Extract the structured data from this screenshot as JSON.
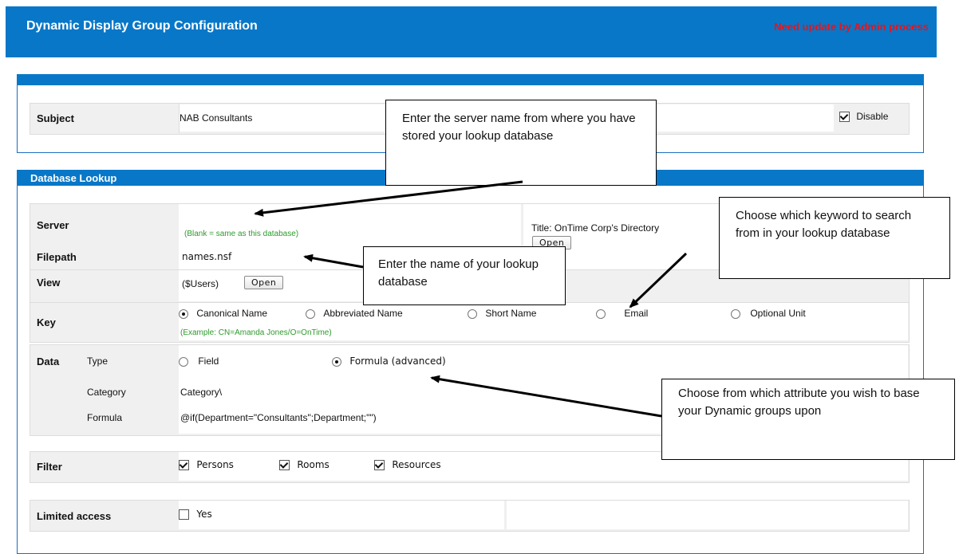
{
  "header": {
    "title": "Dynamic Display Group Configuration",
    "status": "Need update by Admin process"
  },
  "subject_section": {
    "label": "Subject",
    "value": "NAB Consultants",
    "disable_label": "Disable",
    "disable_checked": true
  },
  "db_section": {
    "title": "Database Lookup",
    "server": {
      "label": "Server",
      "hint": "(Blank = same as this database)"
    },
    "filepath": {
      "label": "Filepath",
      "value": "names.nsf"
    },
    "view": {
      "label": "View",
      "value": "($Users)",
      "open_label": "Open"
    },
    "title_info": {
      "text": "Title: OnTime Corp's Directory",
      "open_label": "Open"
    },
    "key": {
      "label": "Key",
      "options": [
        "Canonical Name",
        "Abbreviated Name",
        "Short Name",
        "Email",
        "Optional Unit"
      ],
      "selected": "Canonical Name",
      "example": "(Example: CN=Amanda Jones/O=OnTime)"
    },
    "data": {
      "label": "Data",
      "type_label": "Type",
      "type_options": [
        "Field",
        "Formula (advanced)"
      ],
      "type_selected": "Formula (advanced)",
      "category_label": "Category",
      "category_value": "Category\\",
      "formula_label": "Formula",
      "formula_value": "@if(Department=\"Consultants\";Department;\"\")"
    },
    "filter": {
      "label": "Filter",
      "options": [
        "Persons",
        "Rooms",
        "Resources"
      ]
    },
    "limited": {
      "label": "Limited access",
      "option": "Yes"
    }
  },
  "callouts": {
    "server": "Enter the server name from where you have stored your lookup database",
    "filepath": "Enter the name of your lookup database",
    "keyword": "Choose which keyword to search from in your lookup database",
    "attribute": "Choose from which attribute you wish to base your Dynamic groups upon"
  }
}
